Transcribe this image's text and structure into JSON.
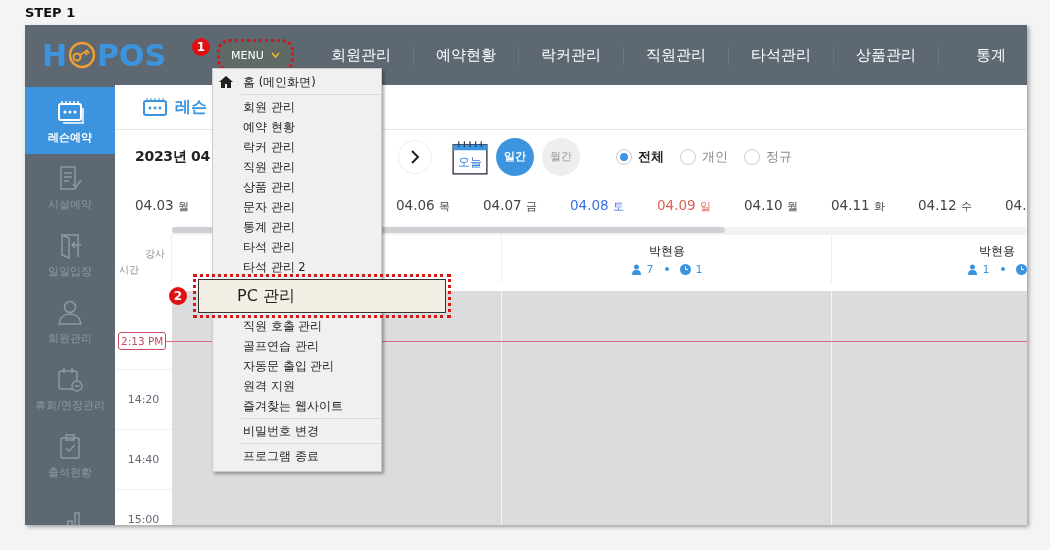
{
  "step_label": "STEP 1",
  "logo": {
    "before": "H",
    "after": "POS"
  },
  "menu_button": {
    "label": "MENU",
    "expanded": true,
    "badge": "1"
  },
  "nav": [
    "회원관리",
    "예약현황",
    "락커관리",
    "직원관리",
    "타석관리",
    "상품관리",
    "통계"
  ],
  "sidebar": [
    {
      "label": "레슨예약",
      "selected": true
    },
    {
      "label": "시설예약",
      "selected": false
    },
    {
      "label": "일일입장",
      "selected": false
    },
    {
      "label": "회원관리",
      "selected": false
    },
    {
      "label": "휴회/연장관리",
      "selected": false
    },
    {
      "label": "출석현황",
      "selected": false
    },
    {
      "selected": false
    }
  ],
  "page_title": "레슨",
  "date_title": "2023년 04",
  "today_label": "오늘",
  "view_toggle": [
    {
      "label": "일간",
      "selected": true
    },
    {
      "label": "월간",
      "selected": false
    }
  ],
  "filter": [
    {
      "label": "전체",
      "selected": true
    },
    {
      "label": "개인",
      "selected": false
    },
    {
      "label": "정규",
      "selected": false
    }
  ],
  "dates": [
    {
      "date": "04.03",
      "weekday": "월",
      "color": "#444444"
    },
    {
      "date": "04.06",
      "weekday": "목",
      "color": "#444444"
    },
    {
      "date": "04.07",
      "weekday": "금",
      "color": "#444444"
    },
    {
      "date": "04.08",
      "weekday": "토",
      "color": "#3b6fe0"
    },
    {
      "date": "04.09",
      "weekday": "일",
      "color": "#e06050"
    },
    {
      "date": "04.10",
      "weekday": "월",
      "color": "#444444"
    },
    {
      "date": "04.11",
      "weekday": "화",
      "color": "#444444"
    },
    {
      "date": "04.12",
      "weekday": "수",
      "color": "#444444"
    },
    {
      "date": "04.",
      "color": "#444444"
    }
  ],
  "grid": {
    "corner_top": "강사",
    "corner_bottom": "시간",
    "columns": [
      {
        "name": "박현용",
        "members": "7",
        "sessions": "1"
      },
      {
        "name": "박현용",
        "members": "1"
      }
    ],
    "now": "2:13 PM",
    "times": [
      "14:20",
      "14:40",
      "15:00"
    ]
  },
  "dropdown": {
    "items": [
      {
        "kind": "home",
        "label": "홈 (메인화면)",
        "selected": false
      },
      {
        "kind": "separator"
      },
      {
        "kind": "item",
        "label": "회원 관리",
        "selected": false
      },
      {
        "kind": "item",
        "label": "예약 현황",
        "selected": false
      },
      {
        "kind": "item",
        "label": "락커 관리",
        "selected": false
      },
      {
        "kind": "item",
        "label": "직원 관리",
        "selected": false
      },
      {
        "kind": "item",
        "label": "상품 관리",
        "selected": false
      },
      {
        "kind": "item",
        "label": "문자 관리",
        "selected": false
      },
      {
        "kind": "item",
        "label": "통계 관리",
        "selected": false
      },
      {
        "kind": "item",
        "label": "타석 관리",
        "selected": false
      },
      {
        "kind": "item",
        "label": "타석 관리 2",
        "selected": false
      },
      {
        "kind": "item",
        "label": "PC 관리",
        "selected": true,
        "badge": "2"
      },
      {
        "kind": "item",
        "label": "직원 호출 관리",
        "selected": false
      },
      {
        "kind": "item",
        "label": "골프연습 관리",
        "selected": false
      },
      {
        "kind": "item",
        "label": "자동문 출입 관리",
        "selected": false
      },
      {
        "kind": "item",
        "label": "원격 지원",
        "selected": false
      },
      {
        "kind": "item",
        "label": "즐겨찾는 웹사이트",
        "selected": false
      },
      {
        "kind": "separator"
      },
      {
        "kind": "item",
        "label": "비밀번호 변경",
        "selected": false
      },
      {
        "kind": "separator"
      },
      {
        "kind": "item",
        "label": "프로그램 종료",
        "selected": false
      }
    ]
  }
}
